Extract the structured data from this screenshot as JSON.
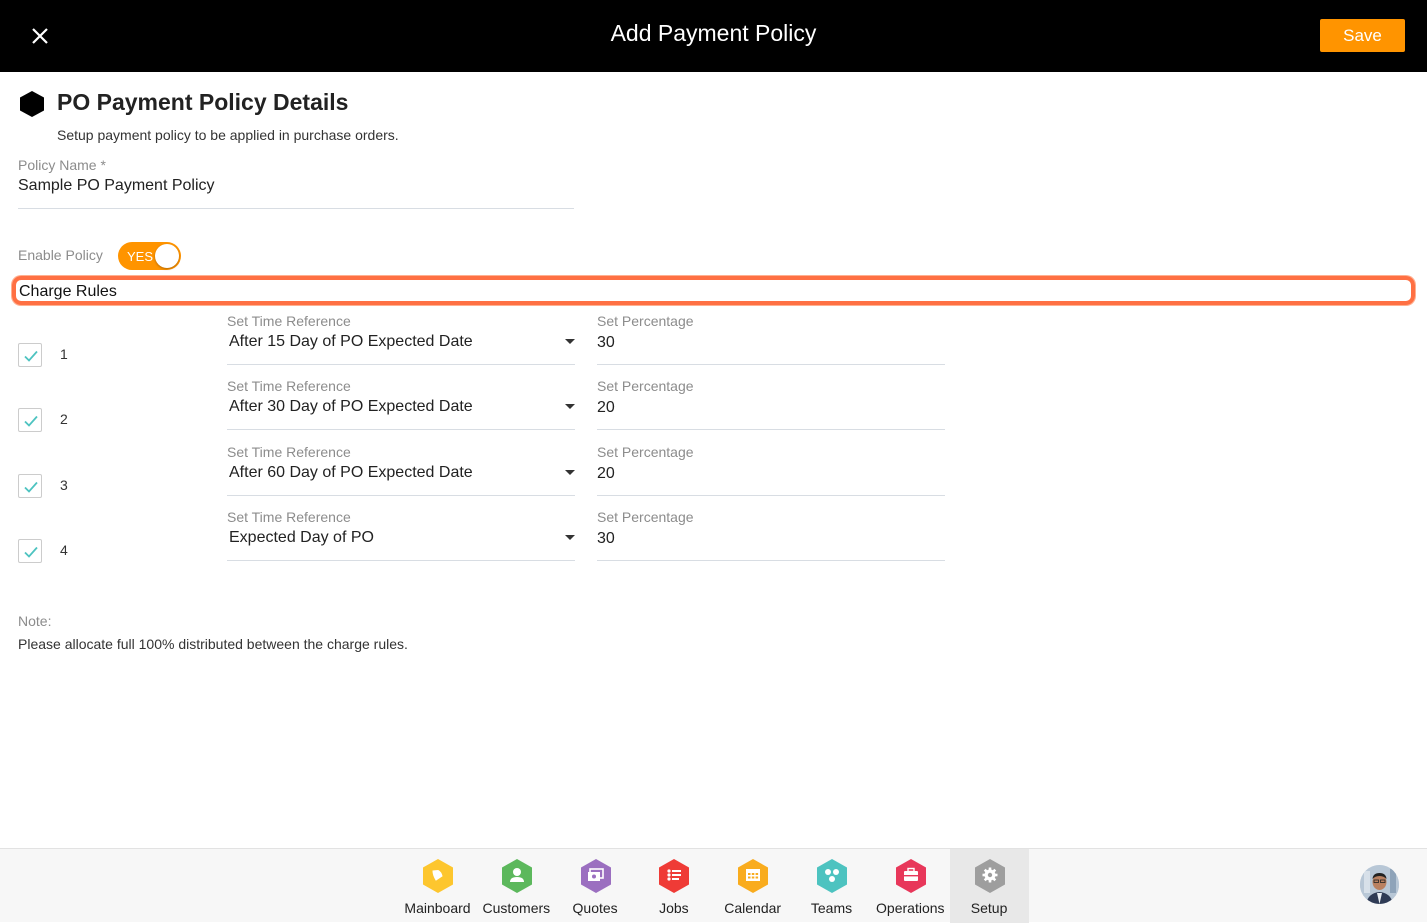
{
  "header": {
    "title": "Add Payment Policy",
    "save_label": "Save",
    "close_icon": "close-icon"
  },
  "section": {
    "icon": "hexagon-icon",
    "title": "PO Payment Policy Details",
    "subtitle": "Setup payment policy to be applied in purchase orders."
  },
  "policy_name": {
    "label": "Policy Name *",
    "value": "Sample PO Payment Policy"
  },
  "enable_policy": {
    "label": "Enable Policy",
    "toggle_text": "YES",
    "enabled": true
  },
  "charge_rules": {
    "title": "Charge Rules",
    "time_label": "Set Time Reference",
    "pct_label": "Set Percentage",
    "rules": [
      {
        "number": "1",
        "checked": true,
        "time_reference": "After 15 Day of PO Expected Date",
        "percentage": "30"
      },
      {
        "number": "2",
        "checked": true,
        "time_reference": "After 30 Day of PO Expected Date",
        "percentage": "20"
      },
      {
        "number": "3",
        "checked": true,
        "time_reference": "After 60 Day of PO Expected Date",
        "percentage": "20"
      },
      {
        "number": "4",
        "checked": true,
        "time_reference": "Expected Day of PO",
        "percentage": "30"
      }
    ]
  },
  "note": {
    "label": "Note:",
    "text": "Please allocate full 100% distributed between the charge rules."
  },
  "bottom_nav": {
    "items": [
      {
        "label": "Mainboard",
        "icon": "mainboard-icon",
        "color": "#fdc62e"
      },
      {
        "label": "Customers",
        "icon": "customers-icon",
        "color": "#5cb85c"
      },
      {
        "label": "Quotes",
        "icon": "quotes-icon",
        "color": "#9b6fc0"
      },
      {
        "label": "Jobs",
        "icon": "jobs-icon",
        "color": "#ef3b36"
      },
      {
        "label": "Calendar",
        "icon": "calendar-icon",
        "color": "#f9ac1e"
      },
      {
        "label": "Teams",
        "icon": "teams-icon",
        "color": "#4dc3c0"
      },
      {
        "label": "Operations",
        "icon": "operations-icon",
        "color": "#e8375a"
      },
      {
        "label": "Setup",
        "icon": "setup-icon",
        "color": "#9e9e9e",
        "active": true
      }
    ]
  },
  "colors": {
    "accent": "#ff9400",
    "highlight": "#ff7043",
    "check": "#4dc3c0"
  }
}
